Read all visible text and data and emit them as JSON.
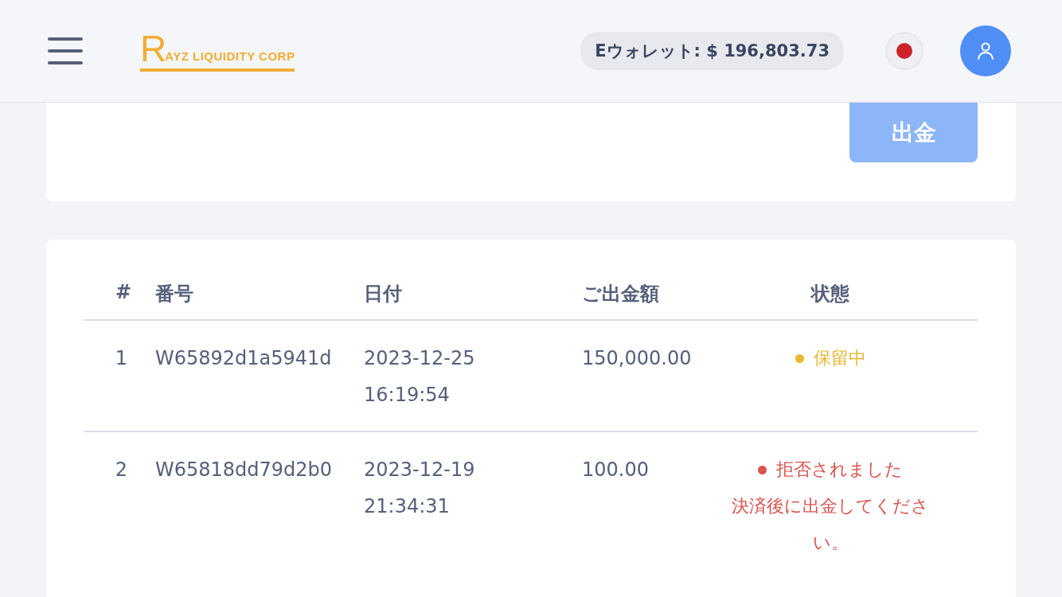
{
  "header": {
    "logo_initial": "R",
    "logo_text": "AYZ LIQUIDITY CORP",
    "wallet": "Eウォレット: $ 196,803.73"
  },
  "withdraw_button": {
    "label": "出金",
    "disabled": true
  },
  "table": {
    "columns": [
      "#",
      "番号",
      "日付",
      "ご出金額",
      "状態"
    ],
    "rows": [
      {
        "index": "1",
        "number": "W65892d1a5941d",
        "date": "2023-12-25",
        "time": "16:19:54",
        "amount": "150,000.00",
        "status": "保留中",
        "color": "#e8b931"
      },
      {
        "index": "2",
        "number": "W65818dd79d2b0",
        "date": "2023-12-19",
        "time": "21:34:31",
        "amount": "100.00",
        "status": "拒否されました",
        "color": "#d9534f",
        "note": "決済後に出金してください。"
      }
    ]
  }
}
